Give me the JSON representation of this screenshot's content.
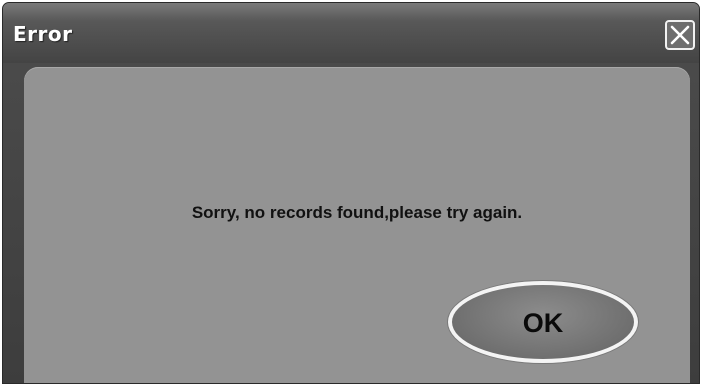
{
  "window": {
    "title": "Error",
    "close_icon": "close-icon"
  },
  "dialog": {
    "message": "Sorry, no records found,please try again.",
    "ok_label": "OK"
  }
}
